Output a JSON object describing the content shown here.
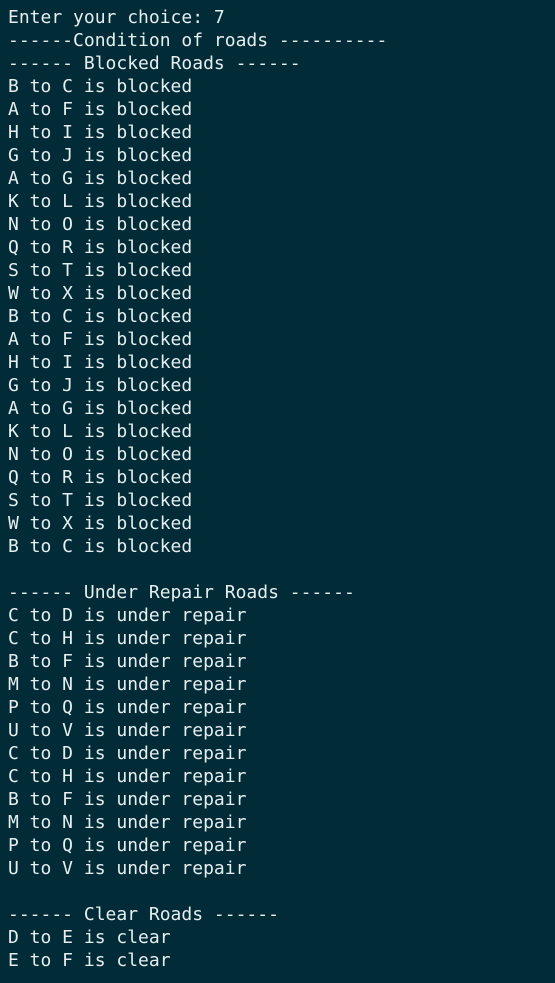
{
  "terminal": {
    "prompt_line": "Enter your choice: 7",
    "header_line": "------Condition of roads ----------",
    "sections": {
      "blocked": {
        "title": "------ Blocked Roads ------",
        "lines": [
          "B to C is blocked",
          "A to F is blocked",
          "H to I is blocked",
          "G to J is blocked",
          "A to G is blocked",
          "K to L is blocked",
          "N to O is blocked",
          "Q to R is blocked",
          "S to T is blocked",
          "W to X is blocked",
          "B to C is blocked",
          "A to F is blocked",
          "H to I is blocked",
          "G to J is blocked",
          "A to G is blocked",
          "K to L is blocked",
          "N to O is blocked",
          "Q to R is blocked",
          "S to T is blocked",
          "W to X is blocked",
          "B to C is blocked"
        ]
      },
      "under_repair": {
        "title": "------ Under Repair Roads ------",
        "lines": [
          "C to D is under repair",
          "C to H is under repair",
          "B to F is under repair",
          "M to N is under repair",
          "P to Q is under repair",
          "U to V is under repair",
          "C to D is under repair",
          "C to H is under repair",
          "B to F is under repair",
          "M to N is under repair",
          "P to Q is under repair",
          "U to V is under repair"
        ]
      },
      "clear": {
        "title": "------ Clear Roads ------",
        "lines": [
          "D to E is clear",
          "E to F is clear"
        ]
      }
    }
  }
}
